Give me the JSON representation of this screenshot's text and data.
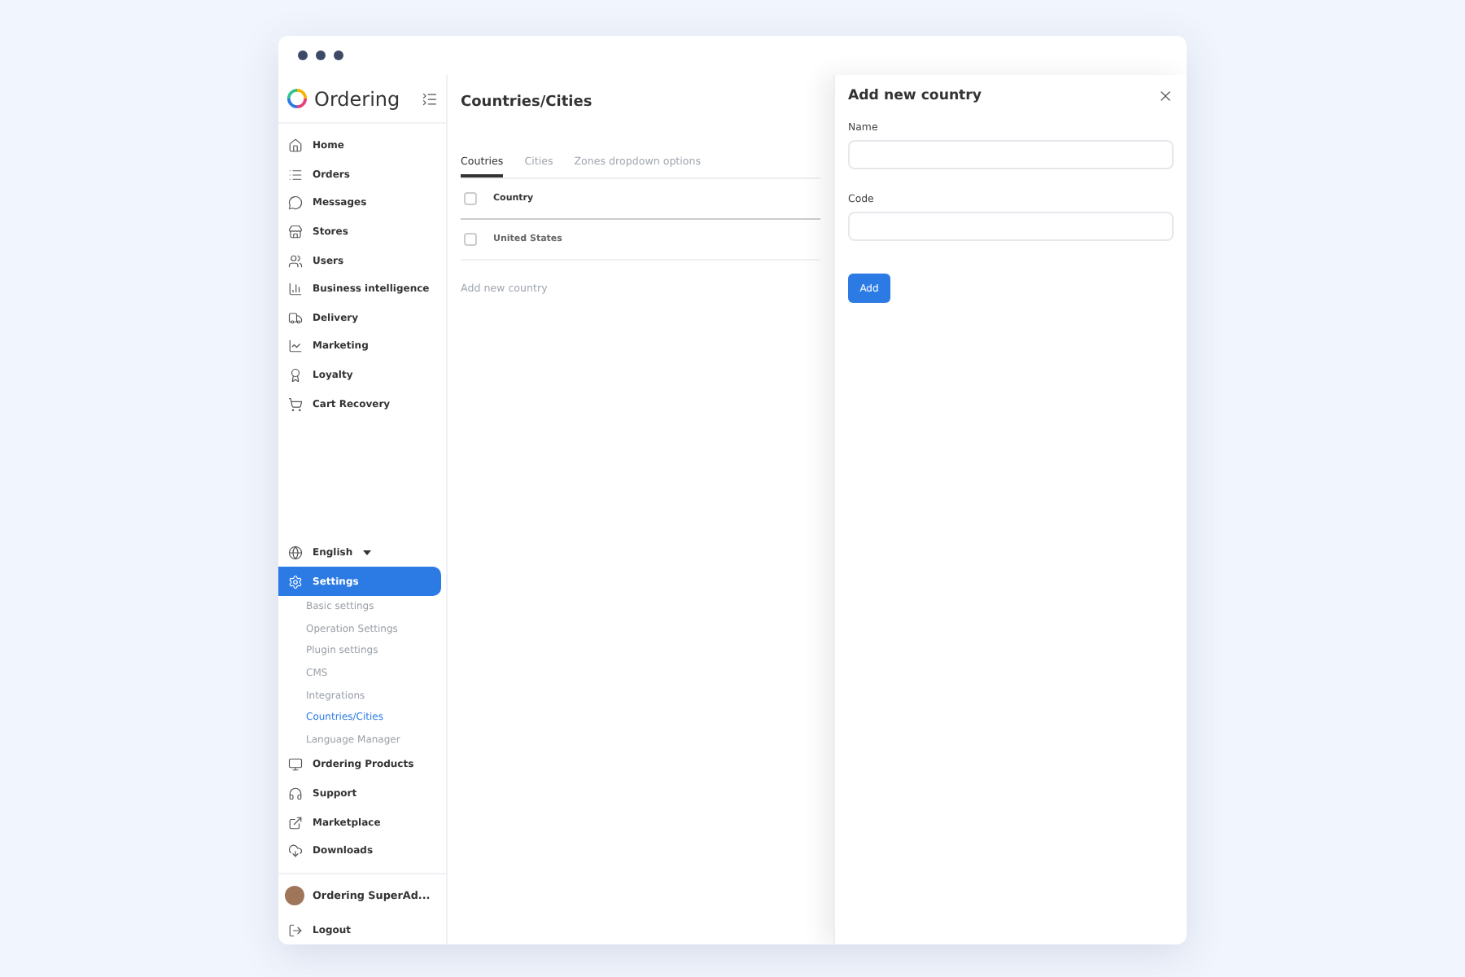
{
  "brand": {
    "name": "Ordering"
  },
  "nav": [
    {
      "label": "Home"
    },
    {
      "label": "Orders"
    },
    {
      "label": "Messages"
    },
    {
      "label": "Stores"
    },
    {
      "label": "Users"
    },
    {
      "label": "Business intelligence"
    },
    {
      "label": "Delivery"
    },
    {
      "label": "Marketing"
    },
    {
      "label": "Loyalty"
    },
    {
      "label": "Cart Recovery"
    }
  ],
  "language": {
    "label": "English"
  },
  "settings": {
    "label": "Settings",
    "selected": true,
    "children": [
      {
        "label": "Basic settings",
        "selected": false
      },
      {
        "label": "Operation Settings",
        "selected": false
      },
      {
        "label": "Plugin settings",
        "selected": false
      },
      {
        "label": "CMS",
        "selected": false
      },
      {
        "label": "Integrations",
        "selected": false
      },
      {
        "label": "Countries/Cities",
        "selected": true
      },
      {
        "label": "Language Manager",
        "selected": false
      }
    ]
  },
  "bottom_nav": [
    {
      "label": "Ordering Products"
    },
    {
      "label": "Support"
    },
    {
      "label": "Marketplace"
    },
    {
      "label": "Downloads"
    }
  ],
  "user": {
    "name": "Ordering SuperAd..."
  },
  "logout": {
    "label": "Logout"
  },
  "page": {
    "title": "Countries/Cities",
    "tabs": [
      {
        "label": "Coutries",
        "selected": true
      },
      {
        "label": "Cities",
        "selected": false
      },
      {
        "label": "Zones dropdown options",
        "selected": false
      }
    ],
    "table": {
      "columns": [
        "Country"
      ],
      "rows": [
        {
          "country": "United States",
          "checked": false
        }
      ],
      "header_checked": false
    },
    "add_link": "Add new country"
  },
  "panel": {
    "title": "Add new country",
    "fields": [
      {
        "label": "Name"
      },
      {
        "label": "Code"
      }
    ],
    "button": "Add"
  }
}
